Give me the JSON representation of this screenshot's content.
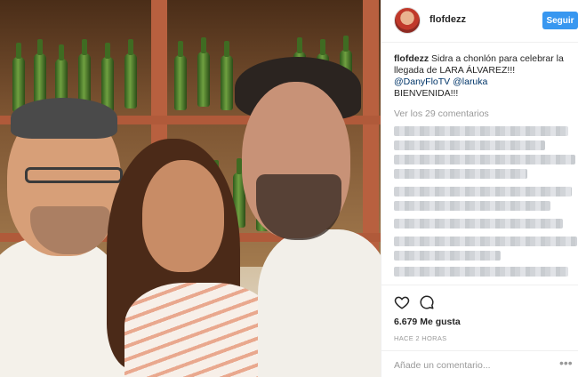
{
  "post": {
    "username": "flofdezz",
    "follow_label": "Seguir",
    "caption": {
      "username": "flofdezz",
      "text_1": "Sidra a chonlón para celebrar la llegada de LARA ÁLVAREZ!!!",
      "mention_1": "@DanyFloTV",
      "mention_2": "@laruka",
      "text_2": "BIENVENIDA!!!"
    },
    "view_comments": "Ver los 29 comentarios",
    "likes": "6.679 Me gusta",
    "time_ago": "HACE 2 HORAS",
    "comment_placeholder": "Añade un comentario...",
    "more_label": "•••",
    "icons": {
      "like": "heart-icon",
      "comment": "speech-bubble-icon",
      "more": "ellipsis-icon"
    },
    "colors": {
      "follow_button": "#3897f0",
      "mention": "#003569",
      "muted": "#999999"
    }
  }
}
